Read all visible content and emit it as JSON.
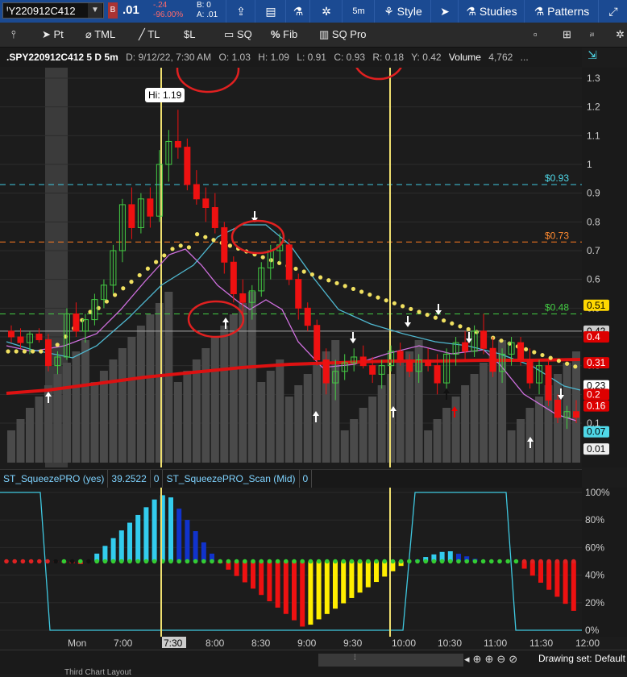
{
  "symbol": {
    "value": "ꞋY220912C412",
    "change": "-.24",
    "change_pct": "-96.00%",
    "bid": "B: 0",
    "ask": "A: .01",
    "last": ".01",
    "flag": "B"
  },
  "toolbar": {
    "timeframe": "5m",
    "style": "Style",
    "studies": "Studies",
    "patterns": "Patterns"
  },
  "draw_tools": [
    "Pt",
    "TML",
    "TL",
    "$L",
    "SQ",
    "Fib",
    "SQ Pro"
  ],
  "info": {
    "symbol": ".SPY220912C412 5 D 5m",
    "date": "D: 9/12/22, 7:30 AM",
    "open": "O: 1.03",
    "high": "H: 1.09",
    "low": "L: 0.91",
    "close": "C: 0.93",
    "range": "R: 0.18",
    "y": "Y: 0.42",
    "volume_label": "Volume",
    "volume": "4,762",
    "more": "..."
  },
  "hi_label": "Hi: 1.19",
  "line_labels": [
    {
      "text": "$0.93",
      "color": "#4fd8e8"
    },
    {
      "text": "$0.73",
      "color": "#ff8a30"
    },
    {
      "text": "$0.48",
      "color": "#44cc44"
    }
  ],
  "price_axis": [
    "1.3",
    "1.2",
    "1.1",
    "1",
    "0.9",
    "0.8",
    "0.7",
    "0.6",
    "0.5",
    "0.4",
    "0.3",
    "0.2",
    "0.1"
  ],
  "price_badges": [
    {
      "text": "0.51",
      "bg": "#ffd700",
      "fg": "#000"
    },
    {
      "text": "0.42",
      "bg": "#ccc",
      "fg": "#000"
    },
    {
      "text": "0.4",
      "bg": "#d00",
      "fg": "#fff"
    },
    {
      "text": "0.31",
      "bg": "#d00",
      "fg": "#fff"
    },
    {
      "text": "0.23",
      "bg": "#fff",
      "fg": "#000"
    },
    {
      "text": "0.2",
      "bg": "#d00",
      "fg": "#fff"
    },
    {
      "text": "0.16",
      "bg": "#d00",
      "fg": "#fff"
    },
    {
      "text": "0.07",
      "bg": "#4fd8e8",
      "fg": "#000"
    },
    {
      "text": "0.01",
      "bg": "#eee",
      "fg": "#000"
    }
  ],
  "study": {
    "name": "ST_SqueezePRO (yes)",
    "value": "39.2522",
    "zero": "0",
    "scan_name": "ST_SqueezePRO_Scan (Mid)",
    "scan_value": "0"
  },
  "pct_axis": [
    "100%",
    "80%",
    "60%",
    "40%",
    "20%",
    "0%"
  ],
  "time_axis": [
    "Mon",
    "7:00",
    "7:30",
    "8:00",
    "8:30",
    "9:00",
    "9:30",
    "10:00",
    "10:30",
    "11:00",
    "11:30",
    "12:00"
  ],
  "time_highlight": "7:30",
  "bottom": {
    "drawing_set": "Drawing set: Default",
    "tab": "Third Chart Layout"
  },
  "colors": {
    "up": "#44cc44",
    "down": "#ee1111",
    "cyan_line": "#4fb8d0",
    "pink_line": "#d070e0",
    "dots": "#f0e060",
    "ma": "#dd1111",
    "hist_up_strong": "#33ccee",
    "hist_up_weak": "#1133cc",
    "hist_dn_strong": "#ee1111",
    "hist_dn_weak": "#ffee00"
  },
  "chart_data": {
    "type": "candlestick",
    "y_range": [
      0.0,
      1.35
    ],
    "candles": [
      [
        0.42,
        0.44,
        0.38,
        0.4
      ],
      [
        0.4,
        0.43,
        0.36,
        0.38
      ],
      [
        0.38,
        0.42,
        0.34,
        0.41
      ],
      [
        0.41,
        0.43,
        0.38,
        0.39
      ],
      [
        0.39,
        0.41,
        0.28,
        0.3
      ],
      [
        0.3,
        0.35,
        0.27,
        0.33
      ],
      [
        0.33,
        0.5,
        0.32,
        0.48
      ],
      [
        0.48,
        0.52,
        0.4,
        0.42
      ],
      [
        0.42,
        0.48,
        0.38,
        0.46
      ],
      [
        0.46,
        0.55,
        0.44,
        0.53
      ],
      [
        0.53,
        0.6,
        0.5,
        0.58
      ],
      [
        0.58,
        0.72,
        0.55,
        0.7
      ],
      [
        0.7,
        0.88,
        0.66,
        0.86
      ],
      [
        0.86,
        0.92,
        0.74,
        0.78
      ],
      [
        0.78,
        0.9,
        0.76,
        0.88
      ],
      [
        0.88,
        0.92,
        0.78,
        0.82
      ],
      [
        0.82,
        1.05,
        0.8,
        1.0
      ],
      [
        1.0,
        1.12,
        0.94,
        1.08
      ],
      [
        1.08,
        1.19,
        1.02,
        1.06
      ],
      [
        1.06,
        1.09,
        0.91,
        0.93
      ],
      [
        0.93,
        0.98,
        0.86,
        0.88
      ],
      [
        0.88,
        0.92,
        0.8,
        0.85
      ],
      [
        0.85,
        0.9,
        0.76,
        0.78
      ],
      [
        0.78,
        0.8,
        0.62,
        0.66
      ],
      [
        0.66,
        0.68,
        0.52,
        0.55
      ],
      [
        0.55,
        0.6,
        0.48,
        0.52
      ],
      [
        0.52,
        0.58,
        0.46,
        0.56
      ],
      [
        0.56,
        0.66,
        0.54,
        0.64
      ],
      [
        0.64,
        0.72,
        0.6,
        0.7
      ],
      [
        0.7,
        0.76,
        0.66,
        0.72
      ],
      [
        0.72,
        0.74,
        0.58,
        0.6
      ],
      [
        0.6,
        0.62,
        0.46,
        0.5
      ],
      [
        0.5,
        0.52,
        0.42,
        0.44
      ],
      [
        0.44,
        0.46,
        0.3,
        0.32
      ],
      [
        0.32,
        0.36,
        0.2,
        0.24
      ],
      [
        0.24,
        0.32,
        0.18,
        0.28
      ],
      [
        0.28,
        0.34,
        0.25,
        0.31
      ],
      [
        0.31,
        0.36,
        0.28,
        0.33
      ],
      [
        0.33,
        0.37,
        0.29,
        0.3
      ],
      [
        0.3,
        0.33,
        0.24,
        0.27
      ],
      [
        0.27,
        0.32,
        0.22,
        0.3
      ],
      [
        0.3,
        0.37,
        0.28,
        0.35
      ],
      [
        0.35,
        0.38,
        0.3,
        0.32
      ],
      [
        0.32,
        0.34,
        0.26,
        0.28
      ],
      [
        0.28,
        0.34,
        0.24,
        0.32
      ],
      [
        0.32,
        0.36,
        0.28,
        0.3
      ],
      [
        0.3,
        0.34,
        0.2,
        0.24
      ],
      [
        0.24,
        0.36,
        0.22,
        0.34
      ],
      [
        0.34,
        0.4,
        0.3,
        0.38
      ],
      [
        0.38,
        0.42,
        0.32,
        0.35
      ],
      [
        0.35,
        0.44,
        0.33,
        0.42
      ],
      [
        0.42,
        0.48,
        0.34,
        0.36
      ],
      [
        0.36,
        0.4,
        0.26,
        0.28
      ],
      [
        0.28,
        0.36,
        0.24,
        0.34
      ],
      [
        0.34,
        0.4,
        0.3,
        0.38
      ],
      [
        0.38,
        0.4,
        0.3,
        0.32
      ],
      [
        0.32,
        0.36,
        0.22,
        0.24
      ],
      [
        0.24,
        0.32,
        0.2,
        0.3
      ],
      [
        0.3,
        0.32,
        0.16,
        0.18
      ],
      [
        0.18,
        0.2,
        0.1,
        0.12
      ],
      [
        0.12,
        0.16,
        0.08,
        0.14
      ],
      [
        0.14,
        0.18,
        0.1,
        0.12
      ]
    ]
  }
}
